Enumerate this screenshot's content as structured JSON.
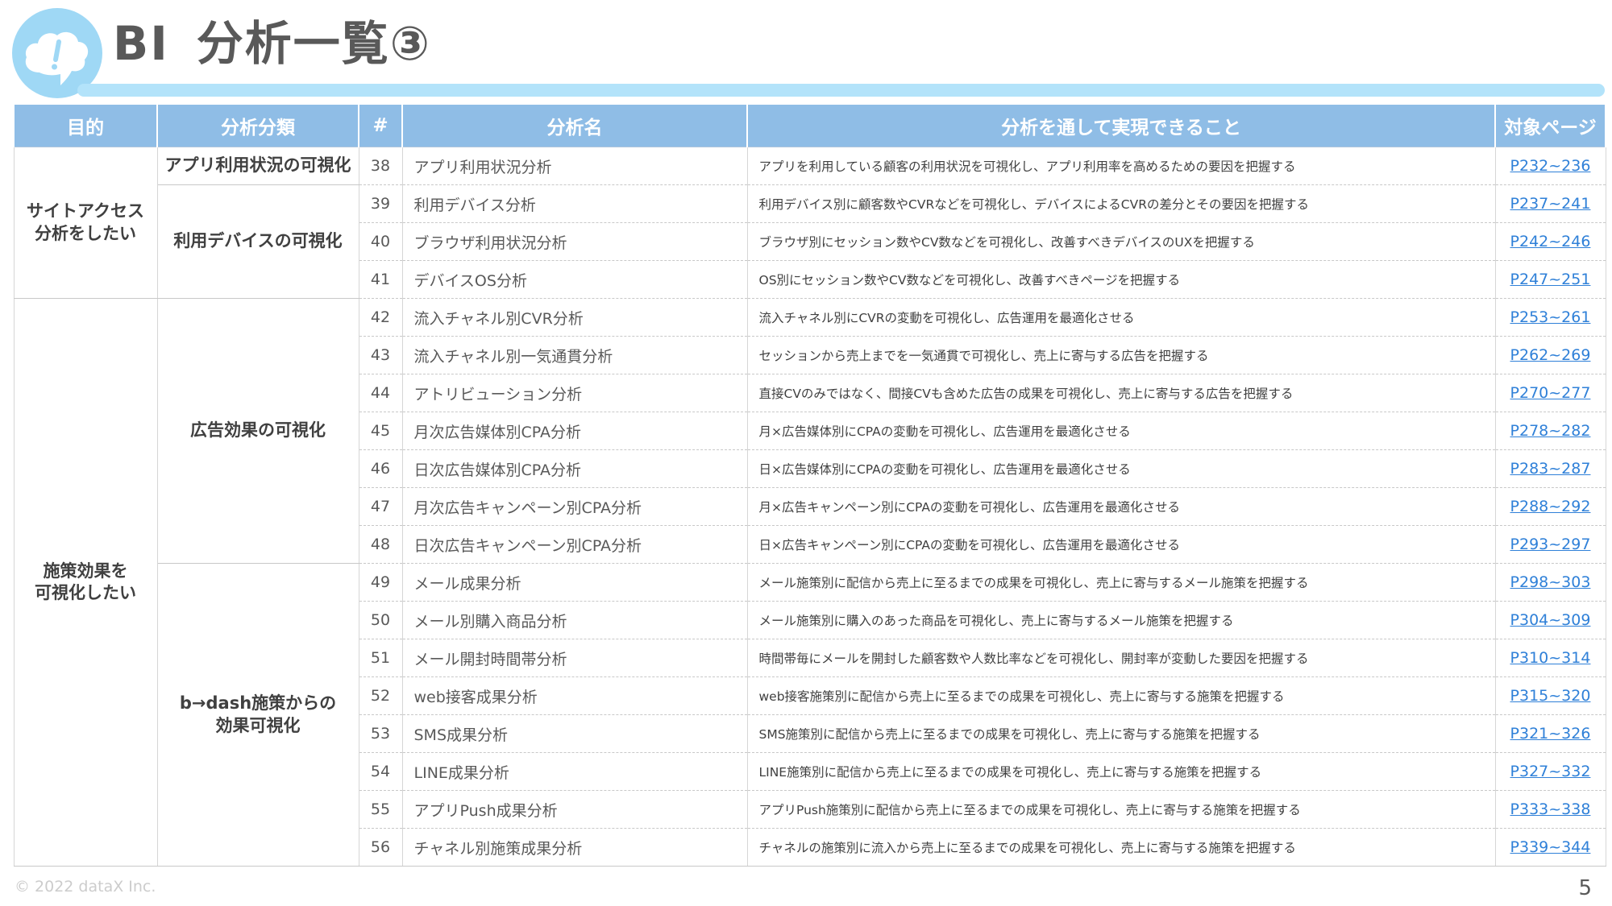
{
  "title": {
    "prefix": "BI",
    "main": "分析一覧③"
  },
  "headers": [
    "目的",
    "分析分類",
    "#",
    "分析名",
    "分析を通して実現できること",
    "対象ページ"
  ],
  "purposes": [
    {
      "line1": "サイトアクセス",
      "line2": "分析をしたい"
    },
    {
      "line1": "施策効果を",
      "line2": "可視化したい"
    }
  ],
  "categories": [
    {
      "line1": "アプリ利用状況の可視化",
      "line2": ""
    },
    {
      "line1": "利用デバイスの可視化",
      "line2": ""
    },
    {
      "line1": "広告効果の可視化",
      "line2": ""
    },
    {
      "line1": "b→dash施策からの",
      "line2": "効果可視化"
    }
  ],
  "rows": [
    {
      "num": "38",
      "name": "アプリ利用状況分析",
      "desc": "アプリを利用している顧客の利用状況を可視化し、アプリ利用率を高めるための要因を把握する",
      "page": "P232~236"
    },
    {
      "num": "39",
      "name": "利用デバイス分析",
      "desc": "利用デバイス別に顧客数やCVRなどを可視化し、デバイスによるCVRの差分とその要因を把握する",
      "page": "P237~241"
    },
    {
      "num": "40",
      "name": "ブラウザ利用状況分析",
      "desc": "ブラウザ別にセッション数やCV数などを可視化し、改善すべきデバイスのUXを把握する",
      "page": "P242~246"
    },
    {
      "num": "41",
      "name": "デバイスOS分析",
      "desc": "OS別にセッション数やCV数などを可視化し、改善すべきページを把握する",
      "page": "P247~251"
    },
    {
      "num": "42",
      "name": "流入チャネル別CVR分析",
      "desc": "流入チャネル別にCVRの変動を可視化し、広告運用を最適化させる",
      "page": "P253~261"
    },
    {
      "num": "43",
      "name": "流入チャネル別一気通貫分析",
      "desc": "セッションから売上までを一気通貫で可視化し、売上に寄与する広告を把握する",
      "page": "P262~269"
    },
    {
      "num": "44",
      "name": "アトリビューション分析",
      "desc": "直接CVのみではなく、間接CVも含めた広告の成果を可視化し、売上に寄与する広告を把握する",
      "page": "P270~277"
    },
    {
      "num": "45",
      "name": "月次広告媒体別CPA分析",
      "desc": "月×広告媒体別にCPAの変動を可視化し、広告運用を最適化させる",
      "page": "P278~282"
    },
    {
      "num": "46",
      "name": "日次広告媒体別CPA分析",
      "desc": "日×広告媒体別にCPAの変動を可視化し、広告運用を最適化させる",
      "page": "P283~287"
    },
    {
      "num": "47",
      "name": "月次広告キャンペーン別CPA分析",
      "desc": "月×広告キャンペーン別にCPAの変動を可視化し、広告運用を最適化させる",
      "page": "P288~292"
    },
    {
      "num": "48",
      "name": "日次広告キャンペーン別CPA分析",
      "desc": "日×広告キャンペーン別にCPAの変動を可視化し、広告運用を最適化させる",
      "page": "P293~297"
    },
    {
      "num": "49",
      "name": "メール成果分析",
      "desc": "メール施策別に配信から売上に至るまでの成果を可視化し、売上に寄与するメール施策を把握する",
      "page": "P298~303"
    },
    {
      "num": "50",
      "name": "メール別購入商品分析",
      "desc": "メール施策別に購入のあった商品を可視化し、売上に寄与するメール施策を把握する",
      "page": "P304~309"
    },
    {
      "num": "51",
      "name": "メール開封時間帯分析",
      "desc": "時間帯毎にメールを開封した顧客数や人数比率などを可視化し、開封率が変動した要因を把握する",
      "page": "P310~314"
    },
    {
      "num": "52",
      "name": "web接客成果分析",
      "desc": "web接客施策別に配信から売上に至るまでの成果を可視化し、売上に寄与する施策を把握する",
      "page": "P315~320"
    },
    {
      "num": "53",
      "name": "SMS成果分析",
      "desc": "SMS施策別に配信から売上に至るまでの成果を可視化し、売上に寄与する施策を把握する",
      "page": "P321~326"
    },
    {
      "num": "54",
      "name": "LINE成果分析",
      "desc": "LINE施策別に配信から売上に至るまでの成果を可視化し、売上に寄与する施策を把握する",
      "page": "P327~332"
    },
    {
      "num": "55",
      "name": "アプリPush成果分析",
      "desc": "アプリPush施策別に配信から売上に至るまでの成果を可視化し、売上に寄与する施策を把握する",
      "page": "P333~338"
    },
    {
      "num": "56",
      "name": "チャネル別施策成果分析",
      "desc": "チャネルの施策別に流入から売上に至るまでの成果を可視化し、売上に寄与する施策を把握する",
      "page": "P339~344"
    }
  ],
  "footer": {
    "copyright": "© 2022 dataX Inc.",
    "page_number": "5"
  },
  "colors": {
    "header_bg": "#8fbde6",
    "accent_light": "#b3e3fa",
    "link": "#2f80d8",
    "logo": "#9fd8f5"
  },
  "icons": {
    "logo": "cloud-exclamation-icon"
  }
}
